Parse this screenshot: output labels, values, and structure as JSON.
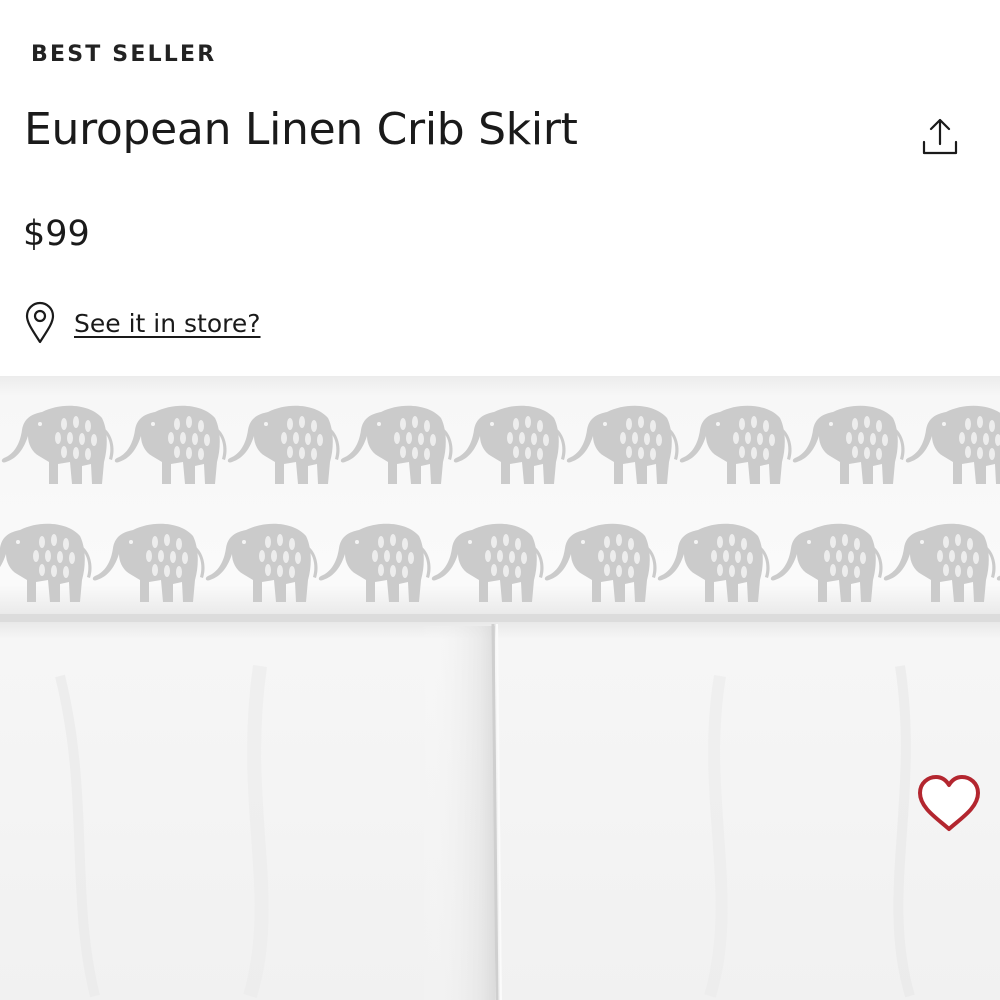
{
  "product": {
    "badge": "BEST SELLER",
    "title": "European Linen Crib Skirt",
    "price": "$99",
    "store_link": "See it in store?"
  },
  "icons": {
    "share": "share-icon",
    "location": "location-pin-icon",
    "favorite": "heart-icon"
  },
  "colors": {
    "favorite_heart": "#b3262f",
    "elephant_print": "#c9c9c9",
    "text": "#1a1a1a"
  }
}
